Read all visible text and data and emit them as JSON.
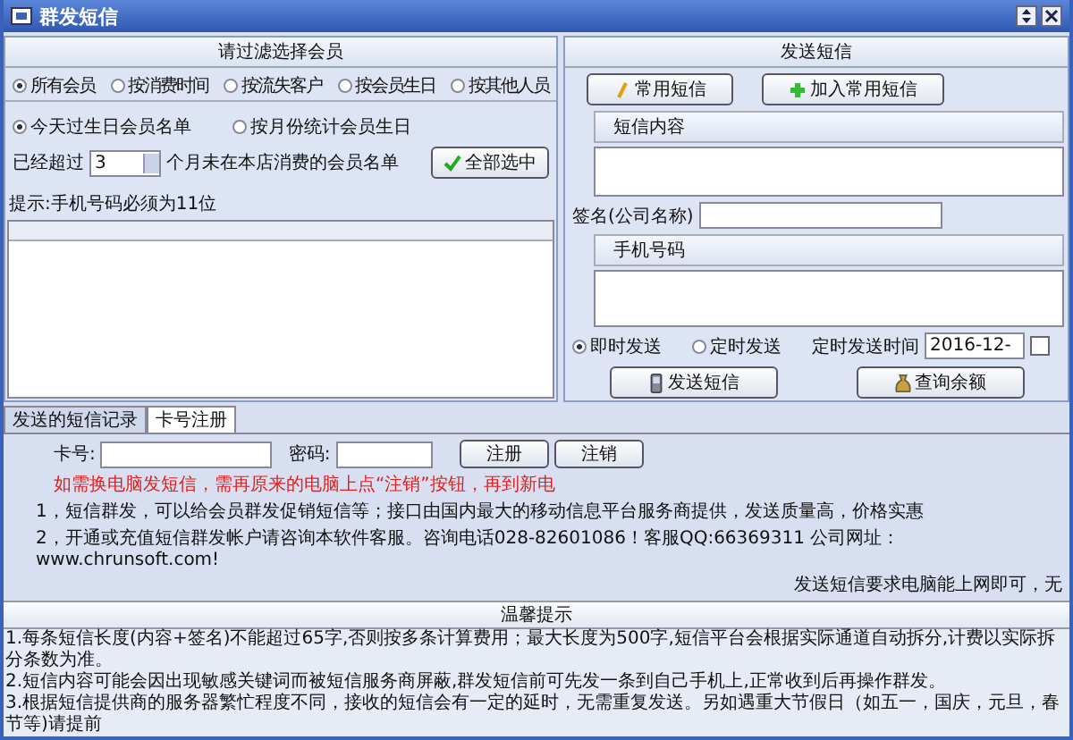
{
  "window": {
    "title": "群发短信"
  },
  "filter_panel": {
    "title": "请过滤选择会员",
    "modes": [
      {
        "label": "所有会员",
        "selected": true
      },
      {
        "label": "按消费时间",
        "selected": false
      },
      {
        "label": "按流失客户",
        "selected": false
      },
      {
        "label": "按会员生日",
        "selected": false
      },
      {
        "label": "按其他人员",
        "selected": false
      }
    ],
    "birthday_options": [
      {
        "label": "今天过生日会员名单",
        "selected": true
      },
      {
        "label": "按月份统计会员生日",
        "selected": false
      }
    ],
    "months_prefix": "已经超过",
    "months_value": "3",
    "months_suffix": "个月未在本店消费的会员名单",
    "select_all_button": "全部选中",
    "hint": "提示:手机号码必须为11位"
  },
  "send_panel": {
    "title": "发送短信",
    "buttons": [
      {
        "label": "常用短信",
        "kind": "pencil"
      },
      {
        "label": "加入常用短信",
        "kind": "plus"
      }
    ],
    "content_label": "短信内容",
    "signature_label": "签名(公司名称)",
    "phone_label": "手机号码",
    "send_modes": [
      {
        "label": "即时发送",
        "selected": true
      },
      {
        "label": "定时发送",
        "selected": false
      }
    ],
    "schedule_label": "定时发送时间",
    "schedule_value": "2016-12-",
    "schedule_checked": false,
    "actions": [
      {
        "label": "发送短信",
        "kind": "phone"
      },
      {
        "label": "查询余额",
        "kind": "bag"
      }
    ]
  },
  "tabs": [
    {
      "label": "发送的短信记录",
      "selected": false
    },
    {
      "label": "卡号注册",
      "selected": true
    }
  ],
  "register": {
    "card_label": "卡号:",
    "password_label": "密码:",
    "register_button": "注册",
    "logout_button": "注销",
    "warning": "如需换电脑发短信，需再原来的电脑上点“注销”按钮，再到新电",
    "info": [
      "1，短信群发，可以给会员群发促销短信等；接口由国内最大的移动信息平台服务商提供，发送质量高，价格实惠",
      "2，开通或充值短信群发帐户请咨询本软件客服。咨询电话028-82601086！客服QQ:66369311 公司网址：www.chrunsoft.com!"
    ],
    "note": "发送短信要求电脑能上网即可，无"
  },
  "tips": {
    "title": "温馨提示",
    "lines": [
      "1.每条短信长度(内容+签名)不能超过65字,否则按多条计算费用；最大长度为500字,短信平台会根据实际通道自动拆分,计费以实际拆分条数为准。",
      "2.短信内容可能会因出现敏感关键词而被短信服务商屏蔽,群发短信前可先发一条到自己手机上,正常收到后再操作群发。",
      "3.根据短信提供商的服务器繁忙程度不同，接收的短信会有一定的延时，无需重复发送。另如遇重大节假日（如五一，国庆，元旦，春节等)请提前"
    ]
  }
}
